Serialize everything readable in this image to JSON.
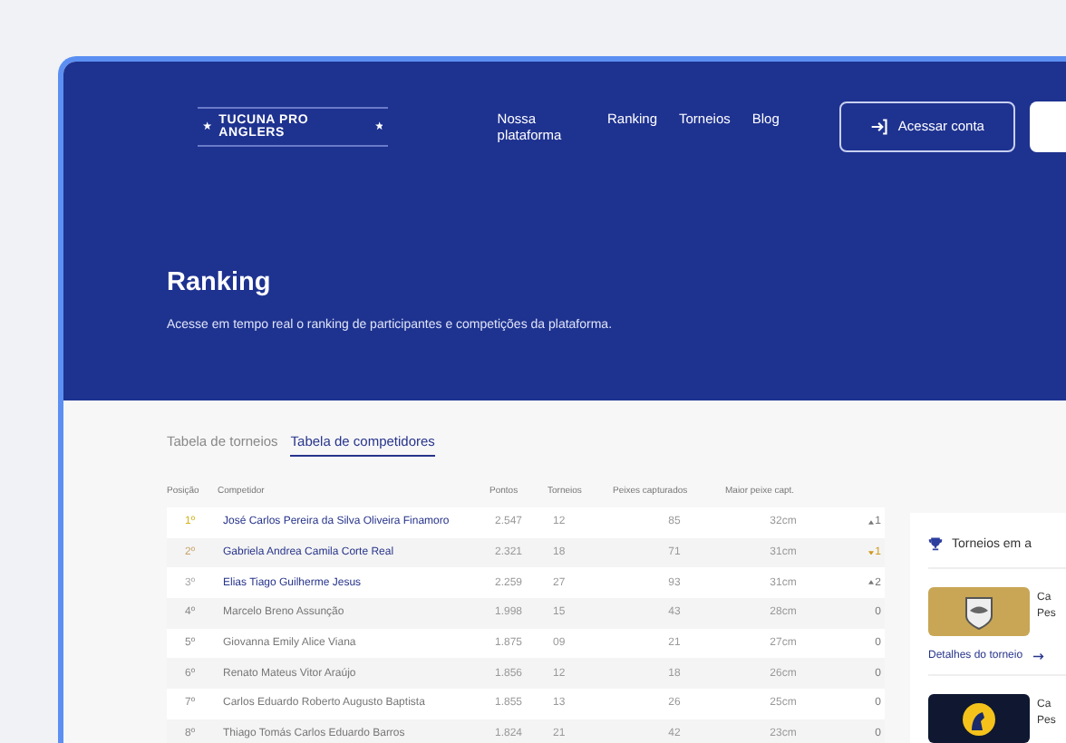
{
  "header": {
    "logo": "TUCUNA PRO ANGLERS",
    "nav": [
      "Nossa plataforma",
      "Ranking",
      "Torneios",
      "Blog"
    ],
    "login_button": "Acessar conta",
    "title": "Ranking",
    "subtitle": "Acesse em tempo real o ranking de participantes e competições da plataforma."
  },
  "tabs": [
    {
      "label": "Tabela de torneios",
      "selected": false
    },
    {
      "label": "Tabela de competidores",
      "selected": true
    }
  ],
  "table": {
    "columns": [
      "Posição",
      "Competidor",
      "Pontos",
      "Torneios",
      "Peixes capturados",
      "Maior peixe capt."
    ],
    "rows": [
      {
        "position": "1º",
        "color": "#d4b21c",
        "name": "José Carlos Pereira da Silva Oliveira Finamoro",
        "highlighted": true,
        "points": "2.547",
        "tournaments": "12",
        "fish": "85",
        "biggest": "32cm",
        "change": {
          "kind": "up",
          "value": "1"
        }
      },
      {
        "position": "2º",
        "color": "#c9a46a",
        "name": "Gabriela Andrea Camila Corte Real",
        "highlighted": true,
        "points": "2.321",
        "tournaments": "18",
        "fish": "71",
        "biggest": "31cm",
        "change": {
          "kind": "down",
          "value": "1"
        }
      },
      {
        "position": "3º",
        "color": "#a9a9a9",
        "name": "Elias Tiago Guilherme Jesus",
        "highlighted": true,
        "points": "2.259",
        "tournaments": "27",
        "fish": "93",
        "biggest": "31cm",
        "change": {
          "kind": "up",
          "value": "2"
        }
      },
      {
        "position": "4º",
        "color": "#8a8a8a",
        "name": "Marcelo Breno Assunção",
        "highlighted": false,
        "points": "1.998",
        "tournaments": "15",
        "fish": "43",
        "biggest": "28cm",
        "change": {
          "kind": "none",
          "value": "0"
        }
      },
      {
        "position": "5º",
        "color": "#8a8a8a",
        "name": "Giovanna Emily Alice Viana",
        "highlighted": false,
        "points": "1.875",
        "tournaments": "09",
        "fish": "21",
        "biggest": "27cm",
        "change": {
          "kind": "none",
          "value": "0"
        }
      },
      {
        "position": "6º",
        "color": "#8a8a8a",
        "name": "Renato Mateus Vitor Araújo",
        "highlighted": false,
        "points": "1.856",
        "tournaments": "12",
        "fish": "18",
        "biggest": "26cm",
        "change": {
          "kind": "none",
          "value": "0"
        }
      },
      {
        "position": "7º",
        "color": "#8a8a8a",
        "name": "Carlos Eduardo Roberto Augusto Baptista",
        "highlighted": false,
        "points": "1.855",
        "tournaments": "13",
        "fish": "26",
        "biggest": "25cm",
        "change": {
          "kind": "none",
          "value": "0"
        }
      },
      {
        "position": "8º",
        "color": "#8a8a8a",
        "name": "Thiago Tomás Carlos Eduardo Barros",
        "highlighted": false,
        "points": "1.824",
        "tournaments": "21",
        "fish": "42",
        "biggest": "23cm",
        "change": {
          "kind": "none",
          "value": "0"
        }
      }
    ]
  },
  "sidebar": {
    "title": "Torneios em a",
    "tournaments": [
      {
        "kind": "light",
        "line_1": "Ca",
        "line_2": "Pes",
        "link": "Detalhes do torneio"
      },
      {
        "kind": "dark",
        "line_1": "Ca",
        "line_2": "Pes"
      }
    ]
  }
}
